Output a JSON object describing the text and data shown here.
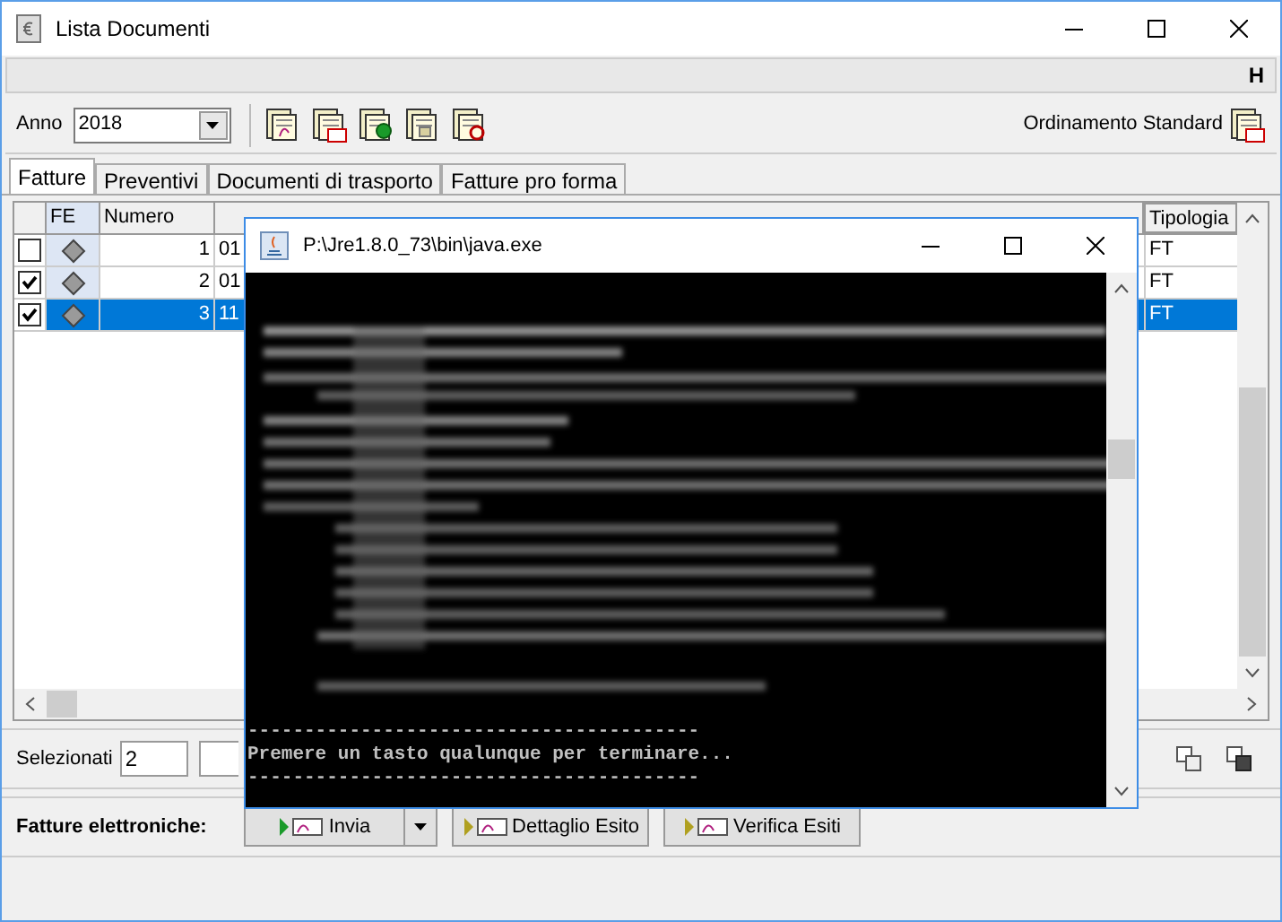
{
  "window": {
    "title": "Lista Documenti"
  },
  "header_bar": {
    "label": "H"
  },
  "toolbar": {
    "year_label": "Anno",
    "year_value": "2018",
    "sort_label": "Ordinamento Standard"
  },
  "tabs": [
    {
      "label": "Fatture",
      "selected": true
    },
    {
      "label": "Preventivi",
      "selected": false
    },
    {
      "label": "Documenti di trasporto",
      "selected": false
    },
    {
      "label": "Fatture pro forma",
      "selected": false
    }
  ],
  "table": {
    "columns": [
      "FE",
      "Numero",
      "Tipologia"
    ],
    "rows": [
      {
        "checked": false,
        "selected": false,
        "numero": "1",
        "data": "01",
        "tipologia": "FT"
      },
      {
        "checked": true,
        "selected": false,
        "numero": "2",
        "data": "01",
        "tipologia": "FT"
      },
      {
        "checked": true,
        "selected": true,
        "numero": "3",
        "data": "11",
        "tipologia": "FT"
      }
    ]
  },
  "selection": {
    "label": "Selezionati",
    "value": "2"
  },
  "e_invoices": {
    "label": "Fatture elettroniche:",
    "buttons": [
      "Invia",
      "Dettaglio Esito",
      "Verifica Esiti"
    ]
  },
  "console": {
    "title": "P:\\Jre1.8.0_73\\bin\\java.exe",
    "lines": [
      "----------------------------------------",
      "Premere un tasto qualunque per terminare...",
      "----------------------------------------"
    ]
  }
}
